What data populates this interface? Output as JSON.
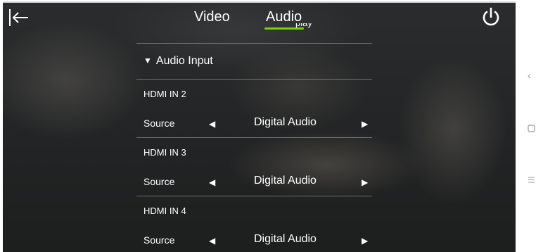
{
  "header": {
    "tabs": [
      {
        "label": "Video"
      },
      {
        "label": "Audio"
      }
    ],
    "active_tab": "Audio",
    "accent_color": "#74d600",
    "clipped_row_text": "play"
  },
  "audio_input": {
    "section_title": "Audio Input",
    "inputs": [
      {
        "name": "HDMI IN 2",
        "source_label": "Source",
        "source_value": "Digital Audio"
      },
      {
        "name": "HDMI IN 3",
        "source_label": "Source",
        "source_value": "Digital Audio"
      },
      {
        "name": "HDMI IN 4",
        "source_label": "Source",
        "source_value": "Digital Audio"
      }
    ]
  },
  "icons": {
    "back": "back-arrow-icon",
    "power": "power-icon",
    "nav_back": "nav-back-icon",
    "nav_home": "nav-home-icon",
    "nav_menu": "nav-menu-icon"
  }
}
